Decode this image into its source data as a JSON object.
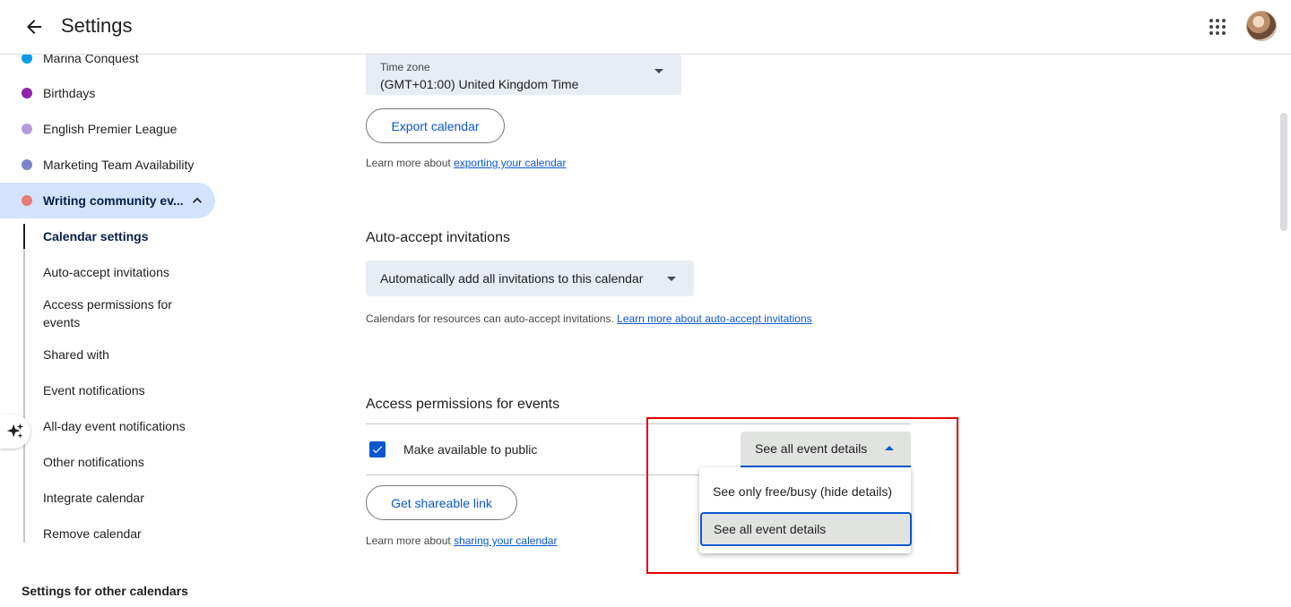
{
  "header": {
    "back_icon": "arrow-left-icon",
    "title": "Settings",
    "apps_icon": "grid-apps-icon",
    "avatar": "user-avatar"
  },
  "sidebar": {
    "calendars": [
      {
        "label": "Marina Conquest",
        "color": "#039be5"
      },
      {
        "label": "Birthdays",
        "color": "#8e24aa"
      },
      {
        "label": "English Premier League",
        "color": "#b39ddb"
      },
      {
        "label": "Marketing Team Availability",
        "color": "#7986cb"
      },
      {
        "label": "Writing community ev...",
        "color": "#e67c73",
        "expanded": true
      }
    ],
    "subitems": [
      "Calendar settings",
      "Auto-accept invitations",
      "Access permissions for events",
      "Shared with",
      "Event notifications",
      "All-day event notifications",
      "Other notifications",
      "Integrate calendar",
      "Remove calendar"
    ],
    "other_calendars": "Settings for other calendars",
    "sparkle_icon": "sparkle-icon"
  },
  "timezone": {
    "label": "Time zone",
    "value": "(GMT+01:00) United Kingdom Time"
  },
  "export": {
    "button": "Export calendar",
    "help_prefix": "Learn more about ",
    "help_link": "exporting your calendar"
  },
  "auto_accept": {
    "title": "Auto-accept invitations",
    "value": "Automatically add all invitations to this calendar",
    "help_prefix": "Calendars for resources can auto-accept invitations. ",
    "help_link": "Learn more about auto-accept invitations"
  },
  "access": {
    "title": "Access permissions for events",
    "public_label": "Make available to public",
    "public_checked": true,
    "select_value": "See all event details",
    "options": [
      "See only free/busy (hide details)",
      "See all event details"
    ],
    "selected_index": 1,
    "share_button": "Get shareable link",
    "help_prefix": "Learn more about ",
    "help_link": "sharing your calendar"
  }
}
